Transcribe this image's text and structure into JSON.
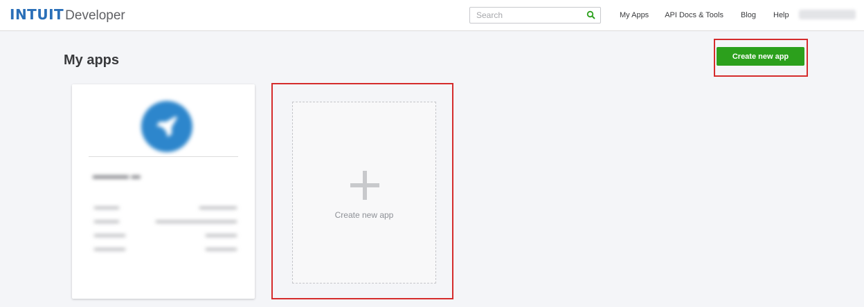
{
  "header": {
    "logo_brand": "INTUIT",
    "logo_product": "Developer",
    "search_placeholder": "Search",
    "nav": [
      "My Apps",
      "API Docs & Tools",
      "Blog",
      "Help"
    ]
  },
  "main": {
    "title": "My apps",
    "create_button_label": "Create new app",
    "create_card_label": "Create new app"
  },
  "colors": {
    "brand": "#2a6fb8",
    "primary_button": "#2ca01c",
    "highlight_frame": "#d52b2b"
  }
}
